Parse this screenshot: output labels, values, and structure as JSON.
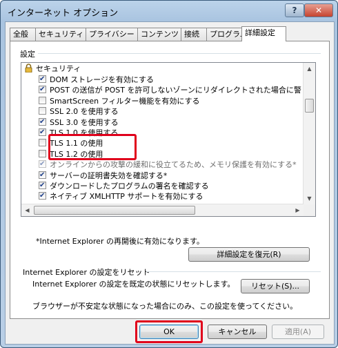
{
  "window": {
    "title": "インターネット オプション",
    "help_button": "?",
    "close_button": "✕"
  },
  "tabs": [
    {
      "label": "全般"
    },
    {
      "label": "セキュリティ"
    },
    {
      "label": "プライバシー"
    },
    {
      "label": "コンテンツ"
    },
    {
      "label": "接続"
    },
    {
      "label": "プログラム"
    },
    {
      "label": "詳細設定",
      "selected": true
    }
  ],
  "settings": {
    "group_label": "設定",
    "category": "セキュリティ",
    "items": [
      {
        "label": "DOM ストレージを有効にする",
        "checked": true
      },
      {
        "label": "POST の送信が POST を許可しないゾーンにリダイレクトされた場合に警",
        "checked": true
      },
      {
        "label": "SmartScreen フィルター機能を有効にする",
        "checked": false
      },
      {
        "label": "SSL 2.0 を使用する",
        "checked": false
      },
      {
        "label": "SSL 3.0 を使用する",
        "checked": true
      },
      {
        "label": "TLS 1.0 を使用する",
        "checked": true
      },
      {
        "label": "TLS 1.1 の使用",
        "checked": false
      },
      {
        "label": "TLS 1.2 の使用",
        "checked": false
      },
      {
        "label": "オンラインからの攻撃の緩和に役立てるため、メモリ保護を有効にする*",
        "checked": true,
        "disabled": true
      },
      {
        "label": "サーバーの証明書失効を確認する*",
        "checked": true
      },
      {
        "label": "ダウンロードしたプログラムの署名を確認する",
        "checked": true
      },
      {
        "label": "ネイティブ XMLHTTP サポートを有効にする",
        "checked": true
      }
    ],
    "restart_note": "*Internet Explorer の再開後に有効になります。",
    "restore_button": "詳細設定を復元(R)"
  },
  "reset": {
    "group_label": "Internet Explorer の設定をリセット",
    "description": "Internet Explorer の設定を既定の状態にリセットします。",
    "button": "リセット(S)...",
    "warning": "ブラウザーが不安定な状態になった場合にのみ、この設定を使ってください。"
  },
  "footer": {
    "ok": "OK",
    "cancel": "キャンセル",
    "apply": "適用(A)"
  },
  "colors": {
    "highlight": "#e0001b",
    "check": "#1e3f8a"
  }
}
